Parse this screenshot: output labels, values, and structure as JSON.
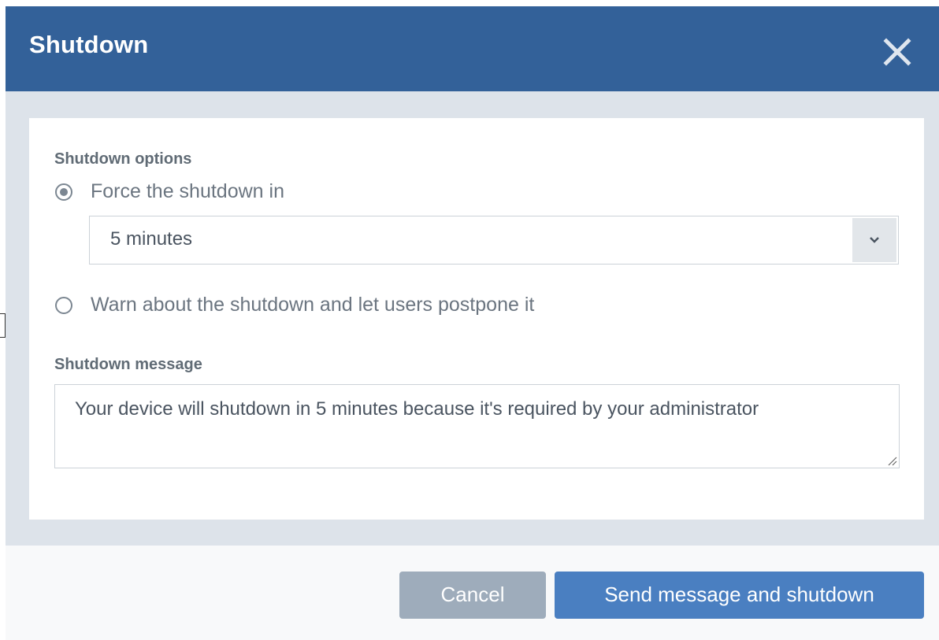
{
  "dialog": {
    "title": "Shutdown",
    "close_icon": "close-icon"
  },
  "shutdown_options": {
    "label": "Shutdown options",
    "options": [
      {
        "label": "Force the shutdown in",
        "selected": true
      },
      {
        "label": "Warn about the shutdown and let users postpone it",
        "selected": false
      }
    ],
    "delay_select": {
      "value": "5 minutes",
      "icon": "chevron-down-icon"
    }
  },
  "shutdown_message": {
    "label": "Shutdown message",
    "value": "Your device will shutdown in 5 minutes because it's required by your administrator"
  },
  "footer": {
    "cancel_label": "Cancel",
    "submit_label": "Send message and shutdown"
  },
  "colors": {
    "header": "#336199",
    "primary_button": "#4a7fc1",
    "cancel_button": "#9eacbb",
    "body_background": "#dde3ea"
  }
}
